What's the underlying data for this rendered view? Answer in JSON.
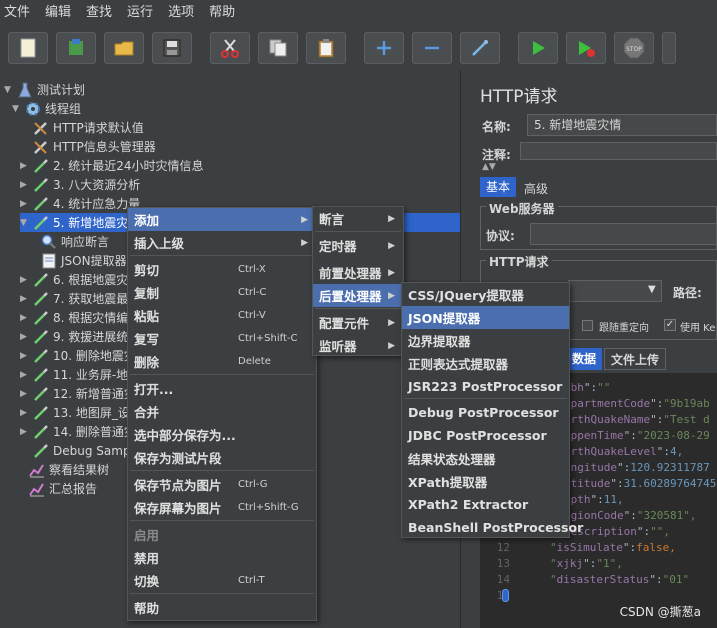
{
  "menubar": [
    "文件",
    "编辑",
    "查找",
    "运行",
    "选项",
    "帮助"
  ],
  "tree": {
    "items": [
      {
        "label": "测试计划",
        "icon": "flask-icon",
        "expanded": true
      },
      {
        "label": "线程组",
        "icon": "gear-icon",
        "expanded": true
      },
      {
        "label": "HTTP请求默认值",
        "icon": "wrench-icon"
      },
      {
        "label": "HTTP信息头管理器",
        "icon": "wrench-icon"
      },
      {
        "label": "2. 统计最近24小时灾情信息",
        "icon": "pipette-icon"
      },
      {
        "label": "3. 八大资源分析",
        "icon": "pipette-icon"
      },
      {
        "label": "4. 统计应急力量",
        "icon": "pipette-icon"
      },
      {
        "label": "5. 新增地震灾情",
        "icon": "pipette-icon"
      },
      {
        "label": "响应断言",
        "icon": "magnifier-icon"
      },
      {
        "label": "JSON提取器",
        "icon": "document-icon"
      },
      {
        "label": "6. 根据地震灾",
        "icon": "pipette-icon"
      },
      {
        "label": "7. 获取地震最",
        "icon": "pipette-icon"
      },
      {
        "label": "8. 根据灾情编",
        "icon": "pipette-icon"
      },
      {
        "label": "9. 救援进展统",
        "icon": "pipette-icon"
      },
      {
        "label": "10. 删除地震灾",
        "icon": "pipette-icon"
      },
      {
        "label": "11. 业务屏-地",
        "icon": "pipette-icon"
      },
      {
        "label": "12. 新增普通灾",
        "icon": "pipette-icon"
      },
      {
        "label": "13. 地图屏_设",
        "icon": "pipette-icon"
      },
      {
        "label": "14. 删除普通灾",
        "icon": "pipette-icon"
      },
      {
        "label": "Debug Samp",
        "icon": "pipette-icon"
      },
      {
        "label": "察看结果树",
        "icon": "chart-icon"
      },
      {
        "label": "汇总报告",
        "icon": "chart-icon"
      }
    ]
  },
  "right_panel": {
    "title": "HTTP请求",
    "name_label": "名称:",
    "name_value": "5. 新增地震灾情",
    "comment_label": "注释:",
    "tabs": [
      "基本",
      "高级"
    ],
    "web_server_label": "Web服务器",
    "protocol_label": "协议:",
    "http_request_label": "HTTP请求",
    "path_label": "路径:",
    "follow_redirect_label": "跟随重定向",
    "use_keepalive_label": "使用 Ke",
    "body_tabs": [
      "数据",
      "文件上传"
    ]
  },
  "editor": {
    "lines": [
      {
        "n": "",
        "k": "gbh",
        "v": "\"\"",
        "t": "str"
      },
      {
        "n": "",
        "k": "epartmentCode",
        "v": "\"9b19ab",
        "t": "str"
      },
      {
        "n": "",
        "k": "arthQuakeName",
        "v": "\"Test d",
        "t": "str"
      },
      {
        "n": "",
        "k": "appenTime",
        "v": "\"2023-08-29",
        "t": "str"
      },
      {
        "n": "",
        "k": "arthQuakeLevel",
        "v": "4,",
        "t": "num"
      },
      {
        "n": "",
        "k": "ongitude",
        "v": "120.92311787",
        "t": "num"
      },
      {
        "n": "",
        "k": "atitude",
        "v": "31.60289764745",
        "t": "num"
      },
      {
        "n": "",
        "k": "epth",
        "v": "11,",
        "t": "num"
      },
      {
        "n": "",
        "k": "egionCode",
        "v": "\"320581\",",
        "t": "str"
      },
      {
        "n": "",
        "k": "description",
        "v": "\"\",",
        "t": "str"
      },
      {
        "n": "12",
        "k": "isSimulate",
        "v": "false,",
        "t": "kw"
      },
      {
        "n": "13",
        "k": "xjkj",
        "v": "\"1\",",
        "t": "str"
      },
      {
        "n": "14",
        "k": "disasterStatus",
        "v": "\"01\"",
        "t": "str"
      },
      {
        "n": "15",
        "k": "",
        "v": "",
        "t": "brace"
      }
    ]
  },
  "menu1": [
    {
      "label": "添加",
      "sc": "",
      "sub": true,
      "hl": true
    },
    {
      "label": "插入上级",
      "sc": "",
      "sub": true
    },
    {
      "label": "剪切",
      "sc": "Ctrl-X"
    },
    {
      "label": "复制",
      "sc": "Ctrl-C"
    },
    {
      "label": "粘贴",
      "sc": "Ctrl-V"
    },
    {
      "label": "复写",
      "sc": "Ctrl+Shift-C"
    },
    {
      "label": "删除",
      "sc": "Delete"
    },
    {
      "label": "打开...",
      "sc": ""
    },
    {
      "label": "合并",
      "sc": ""
    },
    {
      "label": "选中部分保存为...",
      "sc": ""
    },
    {
      "label": "保存为测试片段",
      "sc": ""
    },
    {
      "label": "保存节点为图片",
      "sc": "Ctrl-G"
    },
    {
      "label": "保存屏幕为图片",
      "sc": "Ctrl+Shift-G"
    },
    {
      "label": "启用",
      "sc": "",
      "dis": true
    },
    {
      "label": "禁用",
      "sc": ""
    },
    {
      "label": "切换",
      "sc": "Ctrl-T"
    },
    {
      "label": "帮助",
      "sc": ""
    }
  ],
  "menu2": [
    "断言",
    "定时器",
    "前置处理器",
    "后置处理器",
    "配置元件",
    "监听器"
  ],
  "menu3": [
    "CSS/JQuery提取器",
    "JSON提取器",
    "边界提取器",
    "正则表达式提取器",
    "JSR223 PostProcessor",
    "Debug PostProcessor",
    "JDBC PostProcessor",
    "结果状态处理器",
    "XPath提取器",
    "XPath2 Extractor",
    "BeanShell PostProcessor"
  ],
  "watermark": "CSDN @撕葱a",
  "colors": {
    "accent": "#4b6eaf",
    "selection": "#2f65ca",
    "bg": "#3c3f41"
  }
}
